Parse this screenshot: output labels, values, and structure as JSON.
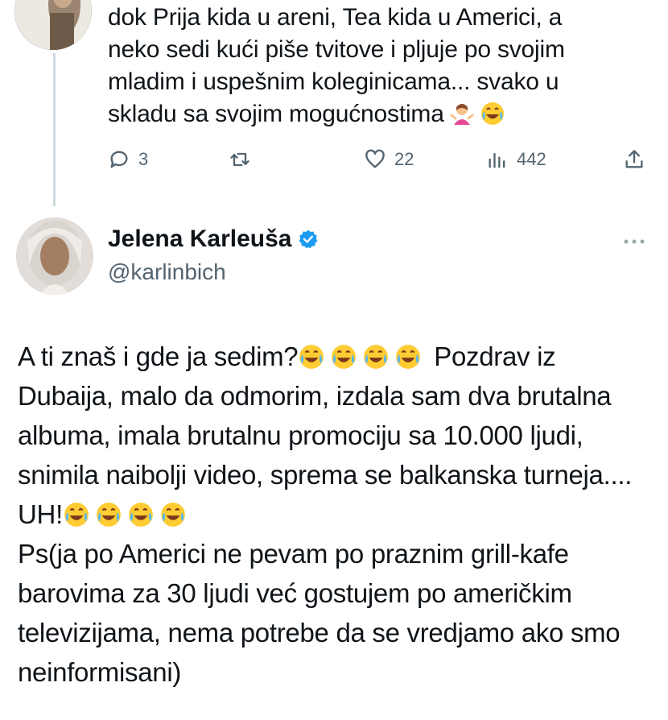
{
  "previous_tweet": {
    "text_lines": [
      "dok Prija kida u areni, Tea kida u Americi, a",
      "neko sedi kući piše tvitove i pljuje po svojim",
      "mladim i uspešnim koleginicama... svako u",
      "skladu sa svojim mogućnostima"
    ],
    "emojis": [
      "person-shrugging-emoji",
      "tears-of-joy-emoji"
    ],
    "actions": {
      "replies": "3",
      "retweets": "",
      "likes": "22",
      "views": "442"
    }
  },
  "tweet": {
    "author_name": "Jelena Karleuša",
    "verified": true,
    "handle": "@karlinbich",
    "segments": [
      {
        "text": "A ti znaš i gde ja sedim?"
      },
      {
        "emoji_count": 4
      },
      {
        "text": " Pozdrav iz Dubaija, malo da odmorim, izdala sam dva brutalna albuma, imala brutalnu promociju sa 10.000 ljudi, snimila naibolji video, sprema se balkanska turneja.... UH!"
      },
      {
        "emoji_count": 4
      },
      {
        "text": "\nPs(ja po Americi ne pevam po praznim grill-kafe barovima za 30 ljudi već gostujem po američkim televizijama, nema potrebe da se vredjamo ako smo neinformisani)"
      }
    ]
  },
  "colors": {
    "text": "#0f1419",
    "secondary": "#536471",
    "verified_blue": "#1d9bf0",
    "thread_line": "#cfd9de"
  },
  "icons": {
    "reply": "reply-icon",
    "retweet": "retweet-icon",
    "like": "heart-icon",
    "views": "views-icon",
    "share": "share-icon",
    "more": "more-icon",
    "verified": "verified-badge-icon"
  }
}
